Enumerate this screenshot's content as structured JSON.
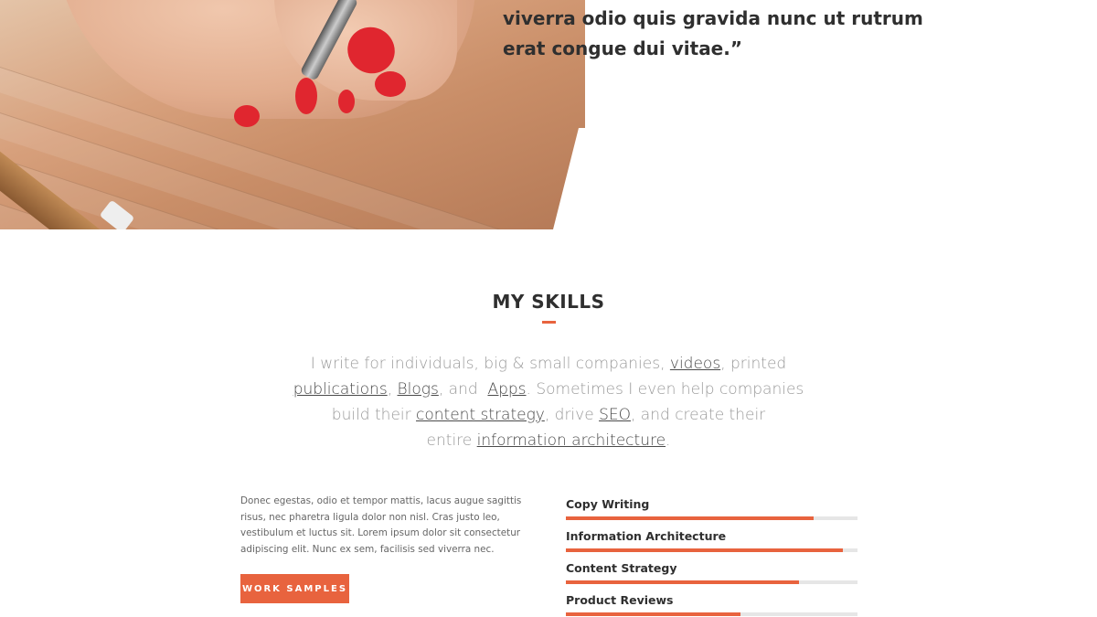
{
  "hero": {
    "quote_lines": [
      "viverra odio quis gravida nunc ut rutrum",
      "erat congue dui vitae.”"
    ]
  },
  "skills_section": {
    "title": "MY SKILLS",
    "intro": {
      "line1": {
        "pre": "I write for individuals, big & small companies, ",
        "link1": "videos",
        "post": ", printed"
      },
      "line2": {
        "link1": "publications",
        "mid1": ", ",
        "link2": "Blogs",
        "mid2": ", and  ",
        "link3": "Apps",
        "post": ". Sometimes I even help companies"
      },
      "line3": {
        "pre": "build their ",
        "link1": "content strategy",
        "mid": ", drive ",
        "link2": "SEO",
        "post": ", and create their"
      },
      "line4": {
        "pre": "entire ",
        "link1": "information architecture",
        "post": "."
      }
    },
    "body_lines": [
      "Donec egestas, odio et tempor mattis, lacus augue sagittis",
      "risus, nec pharetra ligula dolor non nisl. Cras justo leo,",
      "vestibulum et luctus sit. Lorem ipsum dolor sit consectetur",
      "adipiscing elit. Nunc ex sem, facilisis sed viverra nec."
    ],
    "button_label": "WORK SAMPLES",
    "skills": [
      {
        "label": "Copy Writing",
        "level": 0.85
      },
      {
        "label": "Information Architecture",
        "level": 0.95
      },
      {
        "label": "Content Strategy",
        "level": 0.8
      },
      {
        "label": "Product Reviews",
        "level": 0.6
      }
    ]
  },
  "colors": {
    "accent": "#e8633e",
    "heading": "#2f2f2f",
    "muted_text": "#9a9a9a",
    "track": "#e6e6e6"
  }
}
